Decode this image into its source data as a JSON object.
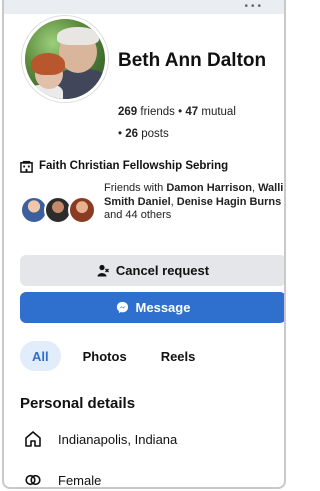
{
  "profile": {
    "name": "Beth Ann Dalton",
    "friends_count": "269",
    "friends_label": "friends",
    "mutual_count": "47",
    "mutual_label": "mutual",
    "posts_count": "26",
    "posts_label": "posts",
    "separator": "•"
  },
  "workplace": {
    "icon": "building-icon",
    "label": "Faith Christian Fellowship Sebring"
  },
  "mutual_friends": {
    "prefix": "Friends with",
    "name1": "Damon Harrison",
    "name2": "Walli Smith Daniel",
    "name3": "Denise Hagin Burns",
    "and_word": "and",
    "others": "44 others"
  },
  "actions": {
    "cancel_label": "Cancel request",
    "cancel_icon": "person-icon",
    "message_label": "Message",
    "message_icon": "messenger-icon"
  },
  "tabs": [
    {
      "label": "All",
      "active": true
    },
    {
      "label": "Photos",
      "active": false
    },
    {
      "label": "Reels",
      "active": false
    }
  ],
  "personal_details": {
    "title": "Personal details",
    "location": "Indianapolis, Indiana",
    "location_icon": "home-icon",
    "gender": "Female",
    "gender_icon": "gender-icon"
  },
  "colors": {
    "accent": "#2f6fce",
    "tab_active_bg": "#e1edfb",
    "button_gray": "#e4e6ea"
  }
}
